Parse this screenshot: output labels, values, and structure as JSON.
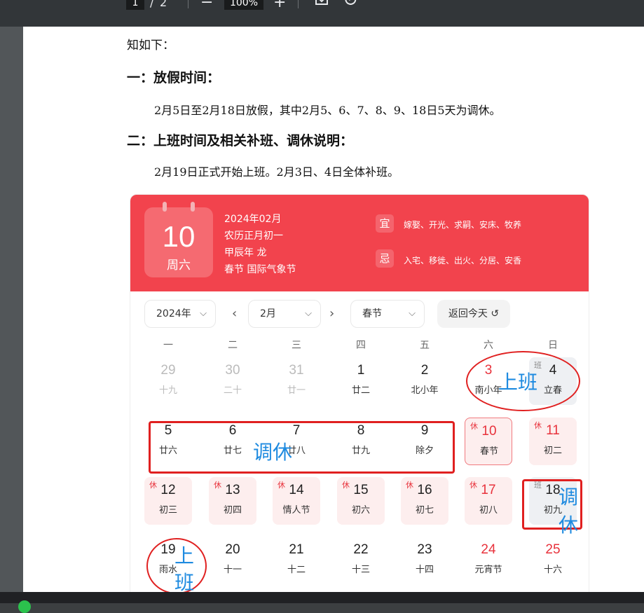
{
  "toolbar": {
    "page_current": "1",
    "page_sep": "/",
    "page_total": "2",
    "zoom": "100%",
    "minus": "−",
    "plus": "+"
  },
  "doc": {
    "intro": "知如下：",
    "h1": "一：放假时间：",
    "p1": "2月5日至2月18日放假，其中2月5、6、7、8、9、18日5天为调休。",
    "h2": "二：上班时间及相关补班、调休说明：",
    "p2": "2月19日正式开始上班。2月3日、4日全体补班。"
  },
  "calendar": {
    "day": "10",
    "weekday": "周六",
    "info": [
      "2024年02月",
      "农历正月初一",
      "甲辰年 龙",
      "春节  国际气象节"
    ],
    "yi_label": "宜",
    "yi_text": "嫁娶、开光、求嗣、安床、牧养",
    "ji_label": "忌",
    "ji_text": "入宅、移徙、出火、分居、安香",
    "year_select": "2024年",
    "month_select": "2月",
    "holiday_select": "春节",
    "today_button": "返回今天 ↺",
    "prev_arrow": "‹",
    "next_arrow": "›",
    "weekdays": [
      "一",
      "二",
      "三",
      "四",
      "五",
      "六",
      "日"
    ],
    "rows": [
      [
        {
          "n": "29",
          "l": "十九",
          "s": "dim"
        },
        {
          "n": "30",
          "l": "二十",
          "s": "dim"
        },
        {
          "n": "31",
          "l": "廿一",
          "s": "dim"
        },
        {
          "n": "1",
          "l": "廿二",
          "s": ""
        },
        {
          "n": "2",
          "l": "北小年",
          "s": ""
        },
        {
          "n": "3",
          "l": "南小年",
          "s": "red"
        },
        {
          "n": "4",
          "l": "立春",
          "s": "work",
          "t": "班"
        }
      ],
      [
        {
          "n": "5",
          "l": "廿六",
          "s": ""
        },
        {
          "n": "6",
          "l": "廿七",
          "s": ""
        },
        {
          "n": "7",
          "l": "廿八",
          "s": ""
        },
        {
          "n": "8",
          "l": "廿九",
          "s": ""
        },
        {
          "n": "9",
          "l": "除夕",
          "s": ""
        },
        {
          "n": "10",
          "l": "春节",
          "s": "holiday red sel",
          "t": "休"
        },
        {
          "n": "11",
          "l": "初二",
          "s": "holiday red",
          "t": "休"
        }
      ],
      [
        {
          "n": "12",
          "l": "初三",
          "s": "holiday",
          "t": "休"
        },
        {
          "n": "13",
          "l": "初四",
          "s": "holiday",
          "t": "休"
        },
        {
          "n": "14",
          "l": "情人节",
          "s": "holiday",
          "t": "休"
        },
        {
          "n": "15",
          "l": "初六",
          "s": "holiday",
          "t": "休"
        },
        {
          "n": "16",
          "l": "初七",
          "s": "holiday",
          "t": "休"
        },
        {
          "n": "17",
          "l": "初八",
          "s": "holiday red",
          "t": "休"
        },
        {
          "n": "18",
          "l": "初九",
          "s": "work",
          "t": "班"
        }
      ],
      [
        {
          "n": "19",
          "l": "雨水",
          "s": ""
        },
        {
          "n": "20",
          "l": "十一",
          "s": ""
        },
        {
          "n": "21",
          "l": "十二",
          "s": ""
        },
        {
          "n": "22",
          "l": "十三",
          "s": ""
        },
        {
          "n": "23",
          "l": "十四",
          "s": ""
        },
        {
          "n": "24",
          "l": "元宵节",
          "s": "red"
        },
        {
          "n": "25",
          "l": "十六",
          "s": "red"
        }
      ]
    ]
  },
  "annotations": {
    "shangban_1": "上班",
    "tiaoxiu_1": "调休",
    "tiaoxiu_2a": "调",
    "tiaoxiu_2b": "休",
    "shangban_2a": "上",
    "shangban_2b": "班"
  }
}
